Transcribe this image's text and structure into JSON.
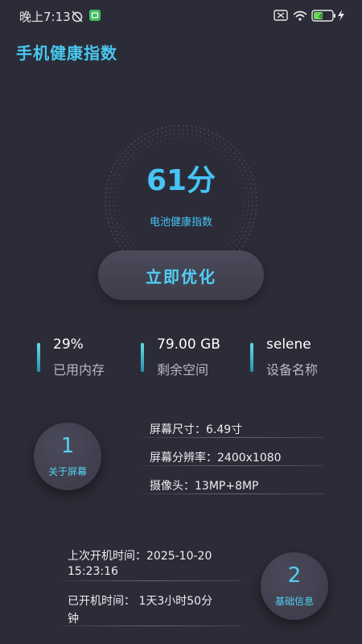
{
  "status_bar": {
    "time": "晚上7:13",
    "battery_level": "41"
  },
  "app": {
    "title": "手机健康指数"
  },
  "gauge": {
    "score": "61分",
    "label": "电池健康指数"
  },
  "optimize_button": {
    "label": "立即优化"
  },
  "stats": [
    {
      "value": "29%",
      "label": "已用内存"
    },
    {
      "value": "79.00 GB",
      "label": "剩余空间"
    },
    {
      "value": "selene",
      "label": "设备名称"
    }
  ],
  "screen_section": {
    "badge_number": "1",
    "badge_label": "关于屏幕",
    "lines": [
      "屏幕尺寸：6.49寸",
      "屏幕分辨率：2400x1080",
      "摄像头：13MP+8MP"
    ]
  },
  "basic_section": {
    "badge_number": "2",
    "badge_label": "基础信息",
    "lines": [
      "上次开机时间：2025-10-20",
      "15:23:16",
      "已开机时间：  1天3小时50分",
      "钟"
    ]
  },
  "colors": {
    "background": "#2c2c38",
    "accent": "#46c4f4",
    "card": "#44444f"
  }
}
